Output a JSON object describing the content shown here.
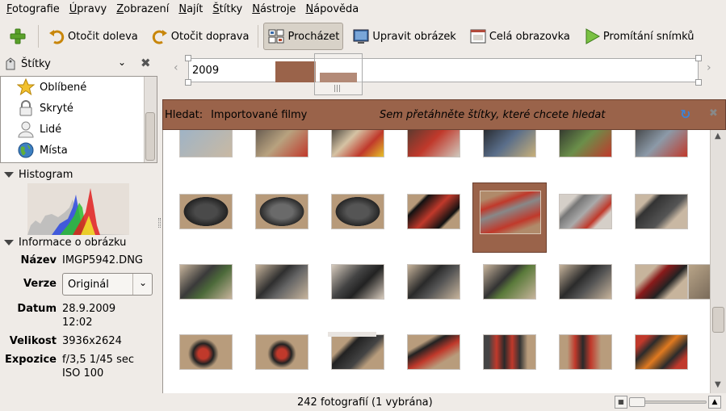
{
  "menu": [
    {
      "key": "F",
      "rest": "otografie"
    },
    {
      "key": "Ú",
      "rest": "pravy"
    },
    {
      "key": "Z",
      "rest": "obrazení"
    },
    {
      "key": "N",
      "rest": "ajít"
    },
    {
      "key": "Š",
      "rest": "títky"
    },
    {
      "key": "N",
      "rest": "ástroje"
    },
    {
      "key": "N",
      "rest": "ápověda"
    }
  ],
  "toolbar": {
    "rotate_left": "Otočit doleva",
    "rotate_right": "Otočit doprava",
    "browse": "Procházet",
    "edit": "Upravit obrázek",
    "fullscreen": "Celá obrazovka",
    "slideshow": "Promítání snímků"
  },
  "sidebar": {
    "tags_title": "Štítky",
    "tags": [
      "Oblíbené",
      "Skryté",
      "Lidé",
      "Místa"
    ],
    "histogram_title": "Histogram",
    "info_title": "Informace o obrázku",
    "info": {
      "name_label": "Název",
      "name_value": "IMGP5942.DNG",
      "version_label": "Verze",
      "version_value": "Originál",
      "date_label": "Datum",
      "date_value": "28.9.2009",
      "time_value": "12:02",
      "size_label": "Velikost",
      "size_value": "3936x2624",
      "exposure_label": "Expozice",
      "exposure_value": "f/3,5 1/45 sec",
      "iso_value": "ISO 100"
    }
  },
  "timeline": {
    "year": "2009"
  },
  "search": {
    "label": "Hledat:",
    "source": "Importované filmy",
    "hint": "Sem přetáhněte štítky, které chcete hledat"
  },
  "status": {
    "text": "242 fotografií (1 vybrána)"
  },
  "colors": {
    "accent": "#9a634a",
    "selected": "#9a634a"
  }
}
